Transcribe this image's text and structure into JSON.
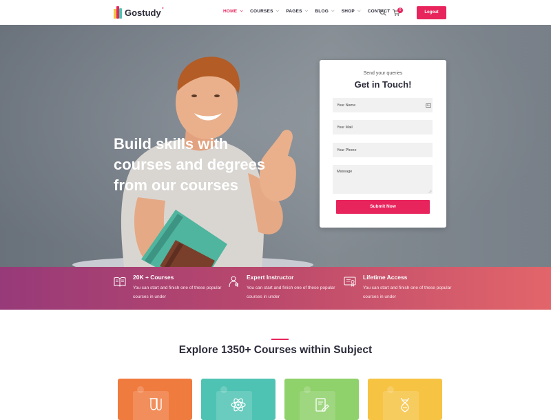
{
  "header": {
    "logo_text": "Gostudy",
    "logo_star": "*",
    "nav": [
      {
        "label": "HOME",
        "has_dropdown": true,
        "active": true
      },
      {
        "label": "COURSES",
        "has_dropdown": true,
        "active": false
      },
      {
        "label": "PAGES",
        "has_dropdown": true,
        "active": false
      },
      {
        "label": "BLOG",
        "has_dropdown": true,
        "active": false
      },
      {
        "label": "SHOP",
        "has_dropdown": true,
        "active": false
      },
      {
        "label": "CONTACT",
        "has_dropdown": false,
        "active": false
      }
    ],
    "cart_count": "0",
    "logout_label": "Logout"
  },
  "hero": {
    "title_lines": [
      "Build skills with",
      "courses and degrees",
      "from our courses"
    ]
  },
  "contact": {
    "subtitle": "Send your queries",
    "title": "Get in Touch!",
    "name_placeholder": "Your Name",
    "mail_placeholder": "Your Mail",
    "phone_placeholder": "Your Phone",
    "message_placeholder": "Massage",
    "submit_label": "Submit Now"
  },
  "features": [
    {
      "title": "20K + Courses",
      "desc": "You can start and finish one of these popular courses in under",
      "icon": "book-icon"
    },
    {
      "title": "Expert Instructor",
      "desc": "You can start and finish one of these popular courses in under",
      "icon": "instructor-icon"
    },
    {
      "title": "Lifetime Access",
      "desc": "You can start and finish one of these popular courses in under",
      "icon": "certificate-icon"
    }
  ],
  "explore": {
    "title": "Explore 1350+ Courses within Subject"
  },
  "subjects": [
    {
      "icon": "flask-icon",
      "color": "#f07b3f"
    },
    {
      "icon": "atom-icon",
      "color": "#4fc3b3"
    },
    {
      "icon": "document-pen-icon",
      "color": "#8fd16a"
    },
    {
      "icon": "dna-icon",
      "color": "#f6c343"
    }
  ],
  "colors": {
    "accent": "#e8245d",
    "features_gradient_start": "#973a79",
    "features_gradient_end": "#e2656a"
  }
}
